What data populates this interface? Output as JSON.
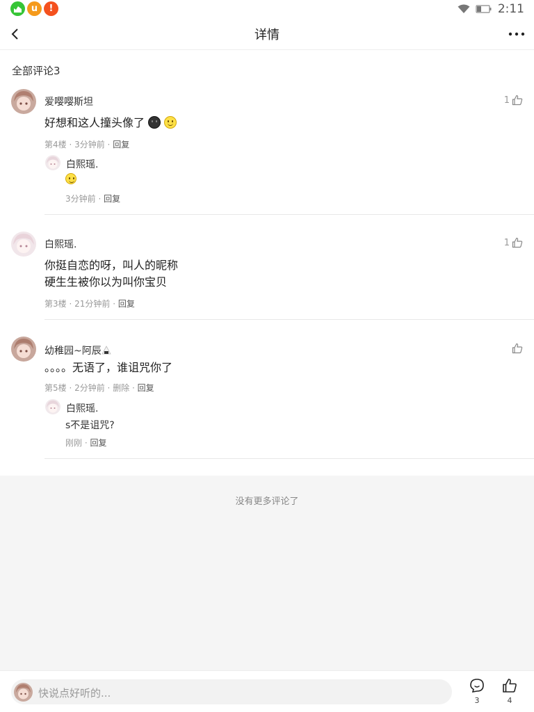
{
  "status_bar": {
    "time": "2:11",
    "app_icons": [
      {
        "icon": "green-app-icon",
        "color": "#37c537",
        "glyph": "▙"
      },
      {
        "icon": "uc-browser-icon",
        "color": "#f59a1b",
        "glyph": "u"
      },
      {
        "icon": "alert-app-icon",
        "color": "#f4511e",
        "glyph": "!"
      }
    ]
  },
  "nav": {
    "title": "详情"
  },
  "section": {
    "title": "全部评论3"
  },
  "comments": [
    {
      "name": "爱嘤嘤斯坦",
      "text": "好想和这人撞头像了",
      "floor": "第4楼",
      "time": "3分钟前",
      "reply_label": "回复",
      "likes": "1",
      "replies": [
        {
          "name": "白熙瑶.",
          "text": "",
          "time": "3分钟前",
          "reply_label": "回复"
        }
      ]
    },
    {
      "name": "白熙瑶.",
      "text_lines": [
        "你挺自恋的呀，叫人的昵称",
        "硬生生被你以为叫你宝贝"
      ],
      "floor": "第3楼",
      "time": "21分钟前",
      "reply_label": "回复",
      "likes": "1"
    },
    {
      "name": "幼稚园~阿辰",
      "text": "。。。。无语了，谁诅咒你了",
      "floor": "第5楼",
      "time": "2分钟前",
      "delete_label": "删除",
      "reply_label": "回复",
      "likes": "",
      "replies": [
        {
          "name": "白熙瑶.",
          "text": "s不是诅咒?",
          "time": "刚刚",
          "reply_label": "回复"
        }
      ]
    }
  ],
  "footer": {
    "no_more": "没有更多评论了"
  },
  "bottom_bar": {
    "placeholder": "快说点好听的...",
    "comment_count": "3",
    "like_count": "4"
  }
}
